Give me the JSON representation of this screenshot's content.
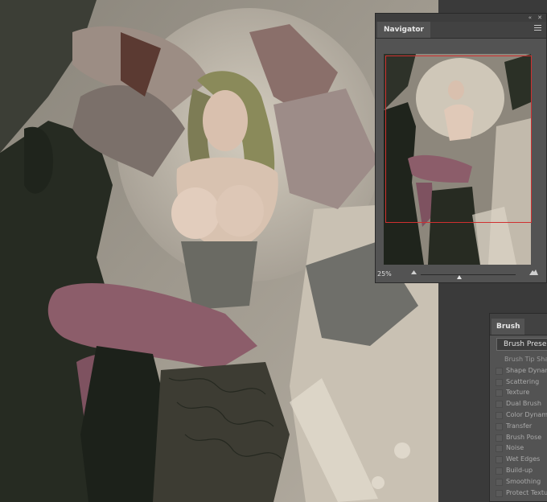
{
  "navigator": {
    "title": "Navigator",
    "zoom": "25%",
    "icons": {
      "collapse": "double-chevron-icon",
      "close": "close-icon",
      "menu": "panel-menu-icon",
      "zoom_out": "small-mountain-icon",
      "zoom_in": "large-mountain-icon"
    }
  },
  "brush_panel": {
    "title": "Brush",
    "presets_button": "Brush Prese",
    "tip_shape": "Brush Tip Shap",
    "options": [
      "Shape Dynam",
      "Scattering",
      "Texture",
      "Dual Brush",
      "Color Dynami",
      "Transfer",
      "Brush Pose",
      "Noise",
      "Wet Edges",
      "Build-up",
      "Smoothing",
      "Protect Textu"
    ]
  }
}
